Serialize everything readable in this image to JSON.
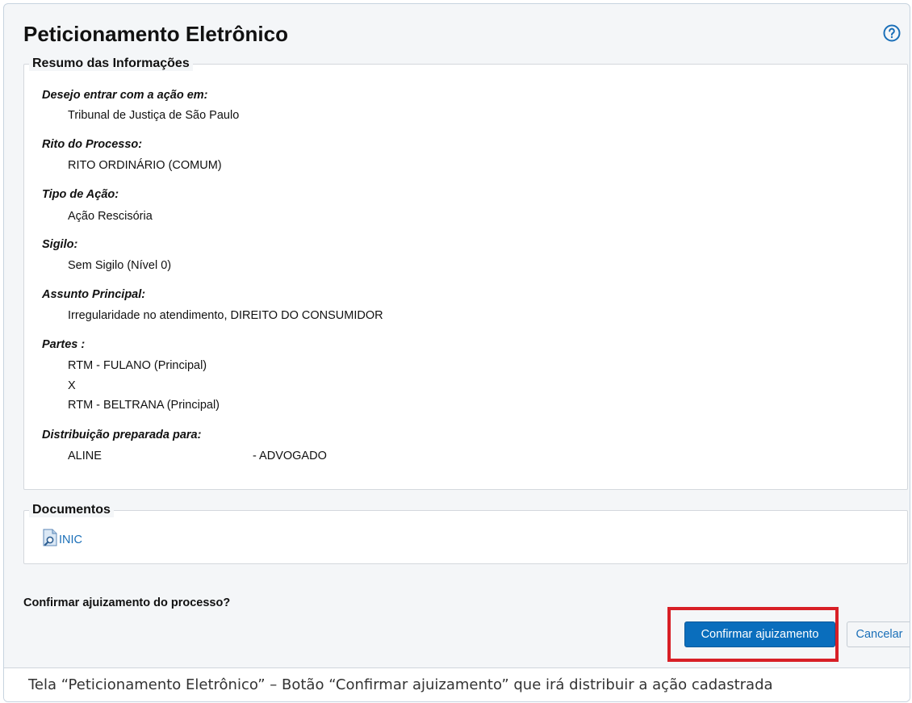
{
  "page": {
    "title": "Peticionamento Eletrônico",
    "help_icon": "question-circle-icon"
  },
  "summary": {
    "legend": "Resumo das Informações",
    "items": [
      {
        "label": "Desejo entrar com a ação em:",
        "values": [
          "Tribunal de Justiça de São Paulo"
        ]
      },
      {
        "label": "Rito do Processo:",
        "values": [
          "RITO ORDINÁRIO (COMUM)"
        ]
      },
      {
        "label": "Tipo de Ação:",
        "values": [
          "Ação Rescisória"
        ]
      },
      {
        "label": "Sigilo:",
        "values": [
          "Sem Sigilo (Nível 0)"
        ]
      },
      {
        "label": "Assunto Principal:",
        "values": [
          "Irregularidade no atendimento, DIREITO DO CONSUMIDOR"
        ]
      },
      {
        "label": "Partes :",
        "values": [
          "RTM - FULANO (Principal)",
          "X",
          "RTM - BELTRANA (Principal)"
        ]
      },
      {
        "label": "Distribuição preparada para:",
        "values": [
          "ALINE",
          "- ADVOGADO"
        ]
      }
    ]
  },
  "documents": {
    "legend": "Documentos",
    "items": [
      {
        "label": "INIC",
        "icon": "document-search-icon"
      }
    ]
  },
  "confirm": {
    "question": "Confirmar ajuizamento do processo?",
    "confirm_label": "Confirmar ajuizamento",
    "cancel_label": "Cancelar"
  },
  "caption": "Tela “Peticionamento Eletrônico” – Botão “Confirmar ajuizamento” que irá distribuir a ação cadastrada",
  "colors": {
    "primary_button": "#0a6ebd",
    "link": "#1a6fb8",
    "highlight": "#d81f26"
  }
}
